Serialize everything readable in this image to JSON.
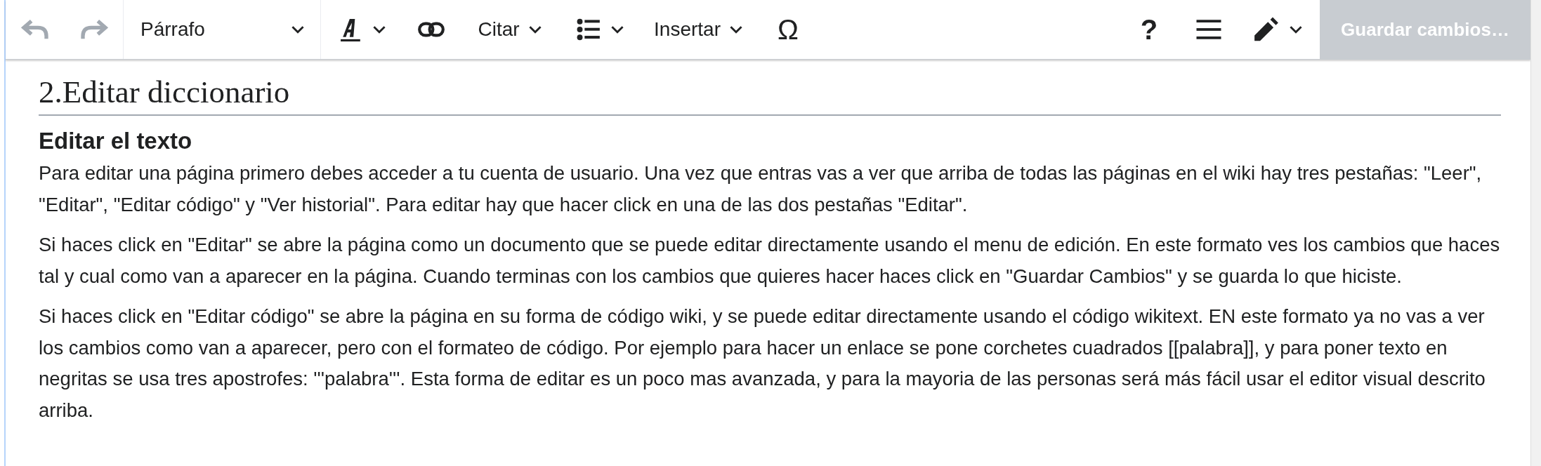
{
  "toolbar": {
    "undo": {
      "disabled": true
    },
    "redo": {
      "disabled": true
    },
    "format": {
      "label": "Párrafo"
    },
    "cite": {
      "label": "Citar"
    },
    "insert": {
      "label": "Insertar"
    },
    "special_character": "Ω",
    "help": "?",
    "save": {
      "label": "Guardar cambios…",
      "disabled": true
    }
  },
  "content": {
    "heading": "2.Editar diccionario",
    "subheading": "Editar el texto",
    "paragraphs": [
      "Para editar una página primero debes acceder a tu cuenta de usuario. Una vez que entras vas a ver que arriba de todas las páginas en el wiki hay tres pestañas: \"Leer\", \"Editar\", \"Editar código\" y \"Ver historial\". Para editar hay que hacer click en una de las dos pestañas \"Editar\".",
      "Si haces click en \"Editar\" se abre la página como un documento que se puede editar directamente usando el menu de edición. En este formato ves los cambios que haces tal y cual como van a aparecer en la página. Cuando terminas con los cambios que quieres hacer haces click en \"Guardar Cambios\" y se guarda lo que hiciste.",
      "Si haces click en \"Editar código\" se abre la página en su forma de código wiki, y se puede editar directamente usando el código wikitext. EN este formato ya no vas a ver los cambios como van a aparecer, pero con el formateo de código. Por ejemplo para hacer un enlace se pone corchetes cuadrados [[palabra]], y para poner texto en negritas se usa tres apostrofes: '''palabra'''. Esta forma de editar es un poco mas avanzada, y para la mayoria de las personas será más fácil usar el editor visual descrito arriba."
    ]
  }
}
